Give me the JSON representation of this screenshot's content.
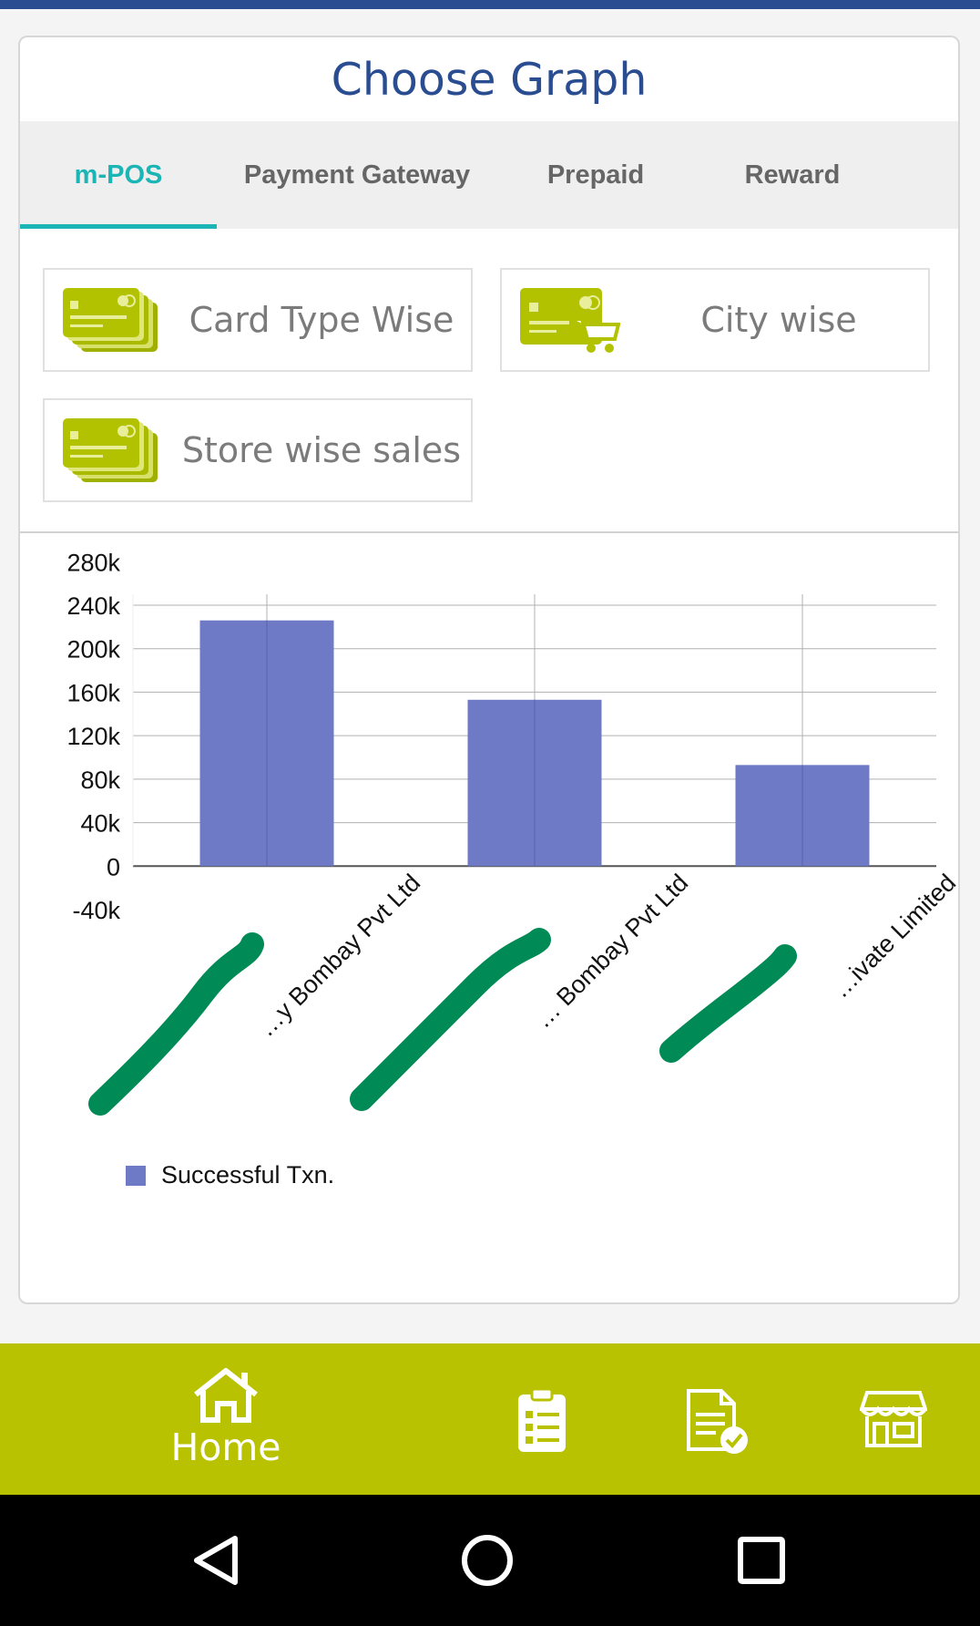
{
  "header": {
    "title": "Choose Graph"
  },
  "tabs": [
    {
      "label": "m-POS",
      "active": true
    },
    {
      "label": "Payment Gateway",
      "active": false
    },
    {
      "label": "Prepaid",
      "active": false
    },
    {
      "label": "Reward",
      "active": false
    }
  ],
  "options": [
    {
      "label": "Card Type Wise",
      "icon": "cards-icon"
    },
    {
      "label": "City wise",
      "icon": "card-cart-icon"
    },
    {
      "label": "Store wise sales",
      "icon": "cards-icon"
    }
  ],
  "chart_data": {
    "type": "bar",
    "categories": [
      "…y Bombay Pvt Ltd",
      "… Bombay Pvt Ltd",
      "…ivate Limited"
    ],
    "series": [
      {
        "name": "Successful Txn.",
        "values": [
          226000,
          153000,
          93000
        ]
      }
    ],
    "ylim": [
      -40000,
      280000
    ],
    "yticks": [
      "280k",
      "240k",
      "200k",
      "160k",
      "120k",
      "80k",
      "40k",
      "0",
      "-40k"
    ],
    "grid": true,
    "legend": "bottom-left",
    "colors": {
      "bar": "#6f7ac6"
    }
  },
  "bottom_nav": {
    "home_label": "Home"
  },
  "colors": {
    "accent": "#1cb5b5",
    "brand": "#2a4d92",
    "nav": "#b8c200"
  }
}
